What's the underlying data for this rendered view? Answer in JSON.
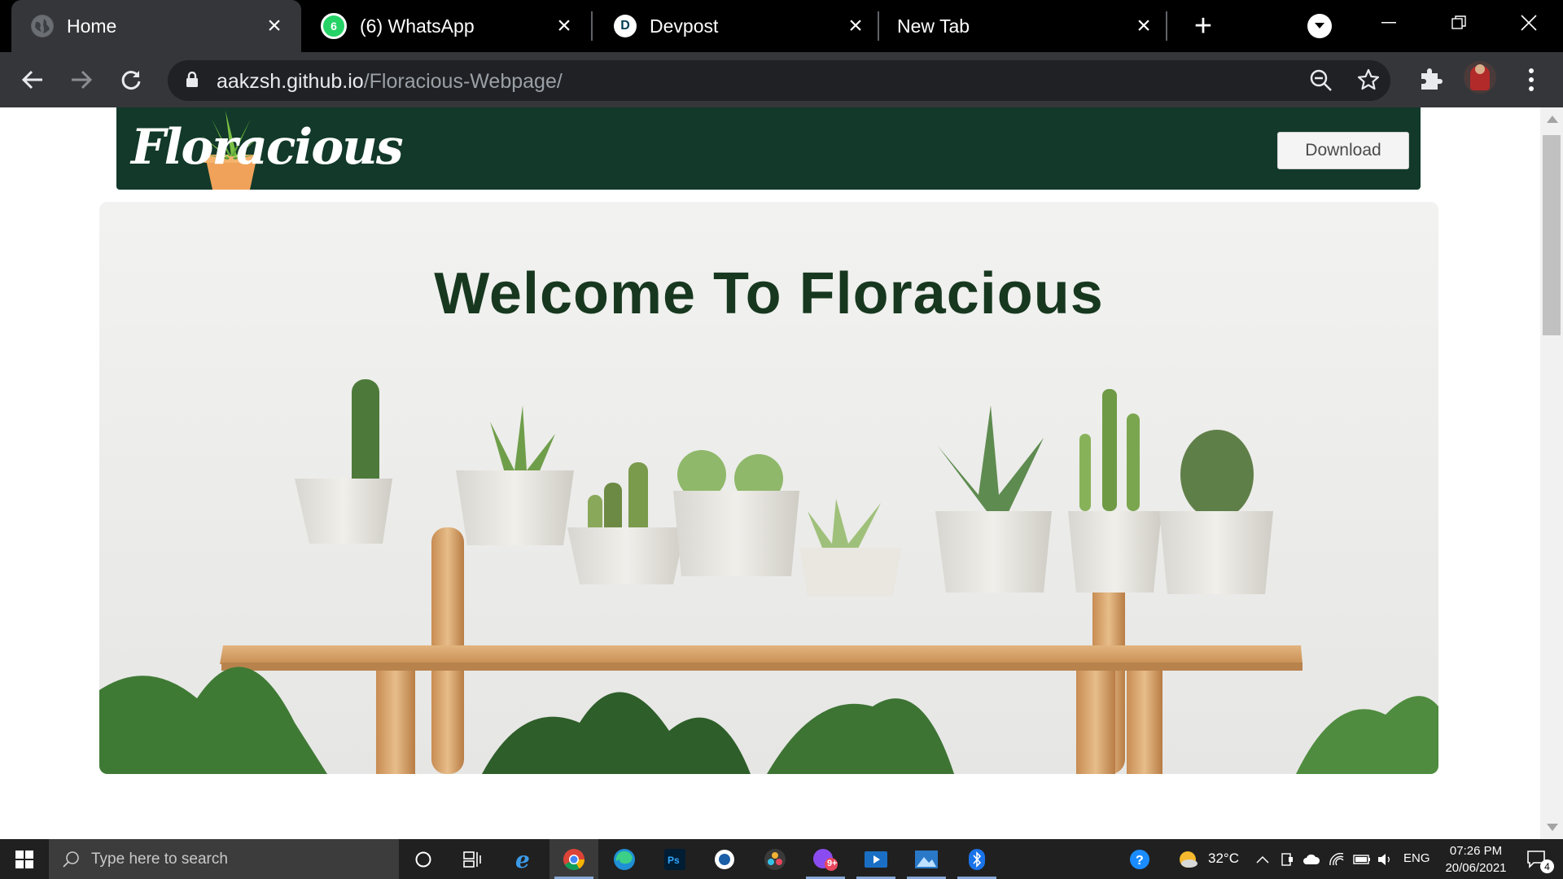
{
  "browser": {
    "tabs": [
      {
        "title": "Home",
        "active": true,
        "icon": "globe-icon"
      },
      {
        "title": "(6) WhatsApp",
        "active": false,
        "icon": "whatsapp-icon",
        "badge": "6"
      },
      {
        "title": "Devpost",
        "active": false,
        "icon": "devpost-icon",
        "icon_letter": "D"
      },
      {
        "title": "New Tab",
        "active": false,
        "icon": ""
      }
    ],
    "url_host": "aakzsh.github.io",
    "url_path": "/Floracious-Webpage/"
  },
  "site": {
    "logo_text": "Floracious",
    "download_label": "Download",
    "hero_title": "Welcome To Floracious"
  },
  "taskbar": {
    "search_placeholder": "Type here to search",
    "weather": "32°C",
    "language": "ENG",
    "time": "07:26 PM",
    "date": "20/06/2021",
    "notifications": "4",
    "messenger_badge": "9+"
  },
  "colors": {
    "brand_dark_green": "#12392a",
    "hero_title": "#17381f",
    "browser_frame": "#35363a",
    "taskbar": "#202020"
  }
}
